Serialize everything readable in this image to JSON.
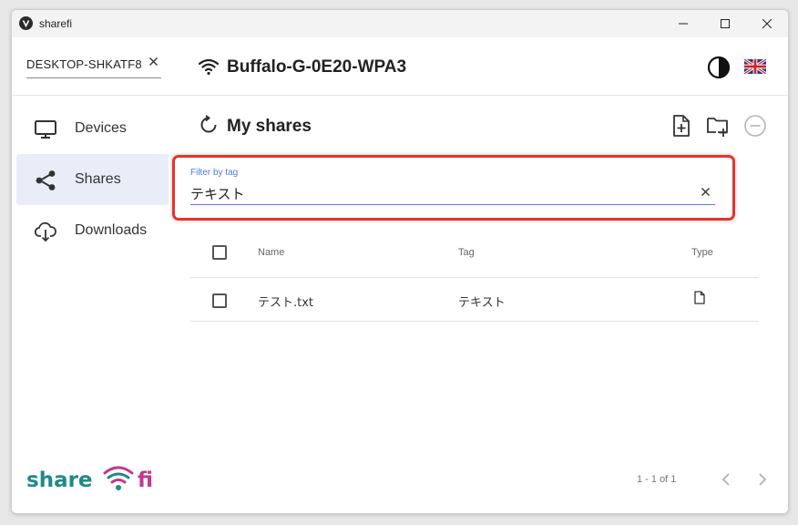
{
  "window": {
    "title": "sharefi"
  },
  "header": {
    "device_name": "DESKTOP-SHKATF8",
    "network_name": "Buffalo-G-0E20-WPA3"
  },
  "sidebar": {
    "items": [
      {
        "label": "Devices",
        "icon": "monitor-icon",
        "active": false
      },
      {
        "label": "Shares",
        "icon": "share-icon",
        "active": true
      },
      {
        "label": "Downloads",
        "icon": "cloud-download-icon",
        "active": false
      }
    ],
    "logo": {
      "text_left": "share",
      "text_right": "fi"
    }
  },
  "main": {
    "title": "My shares",
    "filter": {
      "label": "Filter by tag",
      "value": "テキスト"
    },
    "table": {
      "columns": [
        "Name",
        "Tag",
        "Type"
      ],
      "rows": [
        {
          "name": "テスト.txt",
          "tag": "テキスト",
          "type_icon": "file-icon"
        }
      ]
    },
    "pagination": {
      "text": "1 - 1 of 1"
    }
  },
  "colors": {
    "accent": "#4a7fd6",
    "highlight": "#e3342f",
    "active_nav": "#e8edf8",
    "logo_teal": "#1f8a8a",
    "logo_pink": "#c2388f"
  }
}
